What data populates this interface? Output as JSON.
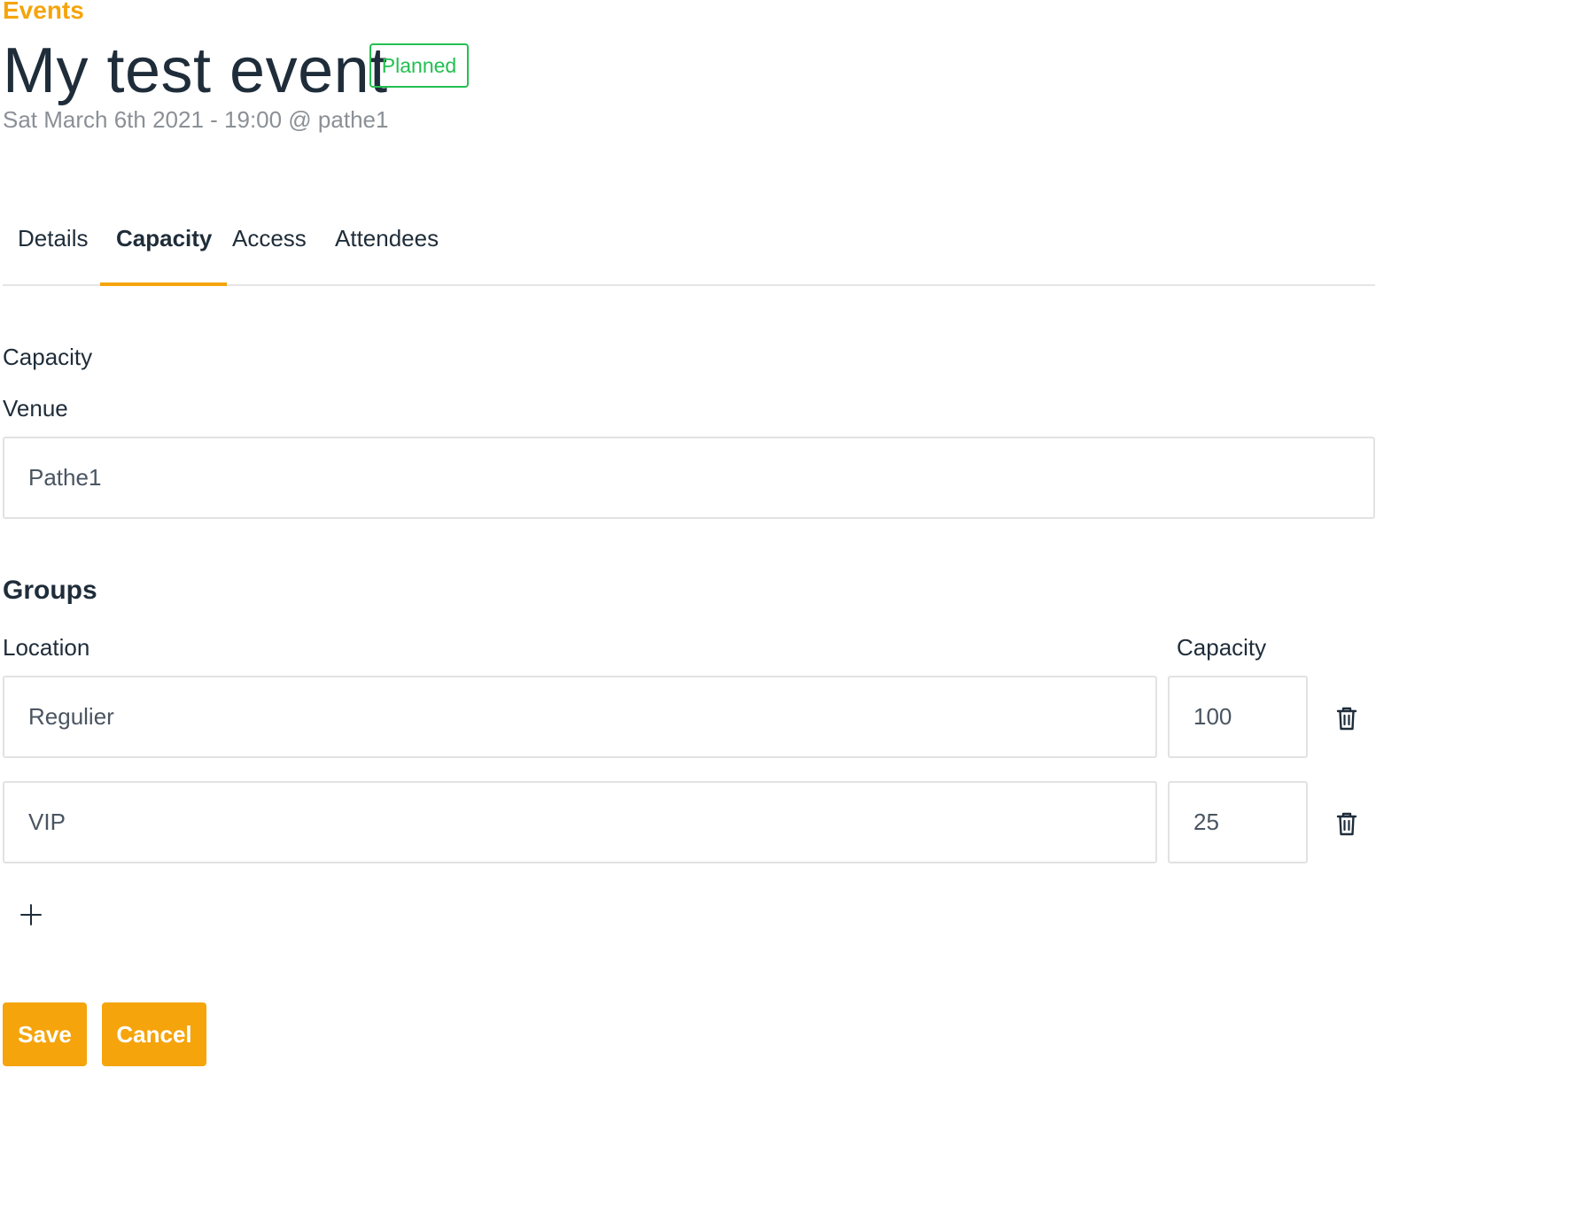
{
  "breadcrumb": "Events",
  "event": {
    "title": "My test event",
    "status": "Planned",
    "status_color": "#23c050",
    "meta": "Sat March 6th 2021 - 19:00 @ pathe1"
  },
  "tabs": [
    {
      "label": "Details",
      "active": false
    },
    {
      "label": "Capacity",
      "active": true
    },
    {
      "label": "Access",
      "active": false
    },
    {
      "label": "Attendees",
      "active": false
    }
  ],
  "capacity_section": {
    "heading": "Capacity",
    "venue_label": "Venue",
    "venue_value": "Pathe1"
  },
  "groups": {
    "title": "Groups",
    "location_header": "Location",
    "capacity_header": "Capacity",
    "rows": [
      {
        "location": "Regulier",
        "capacity": "100"
      },
      {
        "location": "VIP",
        "capacity": "25"
      }
    ],
    "add_icon": "plus-icon",
    "delete_icon": "trash-icon"
  },
  "actions": {
    "save_label": "Save",
    "cancel_label": "Cancel"
  },
  "colors": {
    "accent": "#f5a40c",
    "text": "#1f2d3a",
    "muted": "#8b9096",
    "success": "#23c050"
  }
}
